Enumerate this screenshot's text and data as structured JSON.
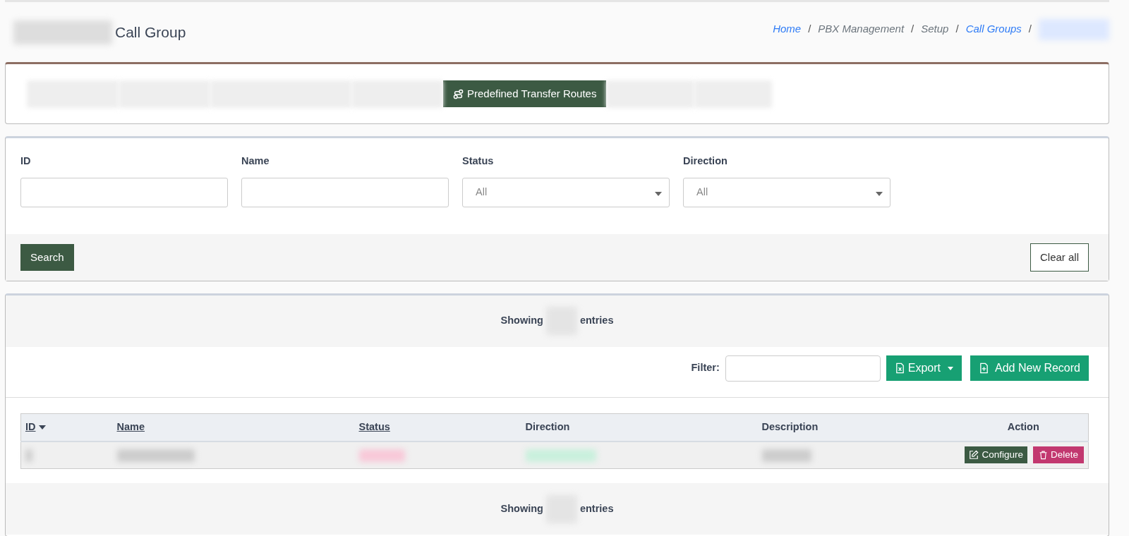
{
  "page_title": "Call Group",
  "breadcrumb": [
    {
      "label": "Home",
      "link": true,
      "separator": "/"
    },
    {
      "label": "PBX Management",
      "link": false,
      "separator": "/"
    },
    {
      "label": "Setup",
      "link": false,
      "separator": "/"
    },
    {
      "label": "Call Groups",
      "link": true,
      "separator": "/"
    },
    {
      "redacted": true,
      "link": true
    }
  ],
  "tabs": [
    {
      "redacted": true,
      "selected": false
    },
    {
      "redacted": true,
      "selected": false
    },
    {
      "redacted": true,
      "selected": false
    },
    {
      "redacted": true,
      "selected": false
    },
    {
      "label": "Predefined Transfer Routes",
      "selected": true
    },
    {
      "redacted": true,
      "selected": false
    },
    {
      "redacted": true,
      "selected": false
    }
  ],
  "search_form": {
    "fields": [
      {
        "label": "ID",
        "kind": "text"
      },
      {
        "label": "Name",
        "kind": "text"
      },
      {
        "label": "Status",
        "kind": "select",
        "value": "All"
      },
      {
        "label": "Direction",
        "kind": "select",
        "value": "All"
      }
    ],
    "search_button": "Search",
    "clear_button": "Clear all"
  },
  "table_info_top": {
    "prefix": "Showing",
    "suffix": "entries"
  },
  "toolbar": {
    "filter_label": "Filter:",
    "export_button": "Export",
    "add_button": "Add New Record"
  },
  "table": {
    "columns": [
      {
        "label": "ID",
        "sortable": true,
        "sorted": true,
        "centered": false
      },
      {
        "label": "Name",
        "sortable": true,
        "sorted": false,
        "centered": false
      },
      {
        "label": "Status",
        "sortable": true,
        "sorted": false,
        "centered": false
      },
      {
        "label": "Direction",
        "sortable": false,
        "sorted": false,
        "centered": false
      },
      {
        "label": "Description",
        "sortable": false,
        "sorted": false,
        "centered": false
      },
      {
        "label": "Action",
        "sortable": false,
        "sorted": false,
        "centered": true
      }
    ],
    "rows": [
      {
        "actions": [
          {
            "label": "Configure",
            "kind": "configure"
          },
          {
            "label": "Delete",
            "kind": "delete"
          }
        ]
      }
    ]
  },
  "table_info_bottom": {
    "prefix": "Showing",
    "suffix": "entries"
  }
}
